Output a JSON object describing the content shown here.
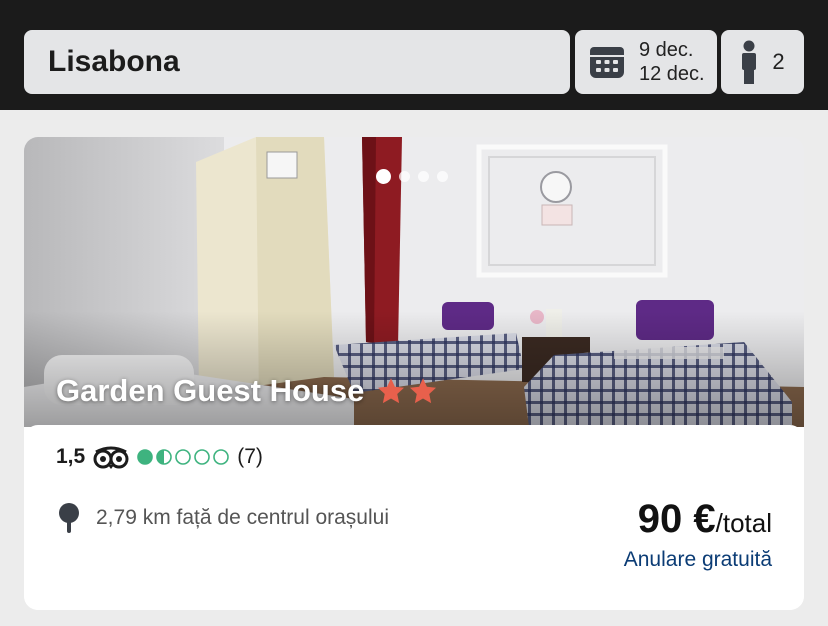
{
  "search": {
    "destination": "Lisabona"
  },
  "dates": {
    "checkin": "9 dec.",
    "checkout": "12 dec.",
    "icon": "calendar-icon"
  },
  "guests": {
    "count": "2",
    "icon": "person-icon"
  },
  "listing": {
    "name": "Garden Guest House",
    "stars": 2,
    "star_color": "#e8604c",
    "carousel": {
      "total": 4,
      "active": 1
    },
    "rating": {
      "score": "1,5",
      "bubbles_filled": 1.5,
      "bubbles_total": 5,
      "reviews": "(7)",
      "bubble_color": "#3eb37f"
    },
    "distance": "2,79 km față de centrul orașului",
    "price": "90 €",
    "price_unit": "/total",
    "cancellation": "Anulare gratuită"
  },
  "colors": {
    "header_bg": "#1b1b1b",
    "field_bg": "#e4e5e7",
    "link": "#0b3c75"
  }
}
